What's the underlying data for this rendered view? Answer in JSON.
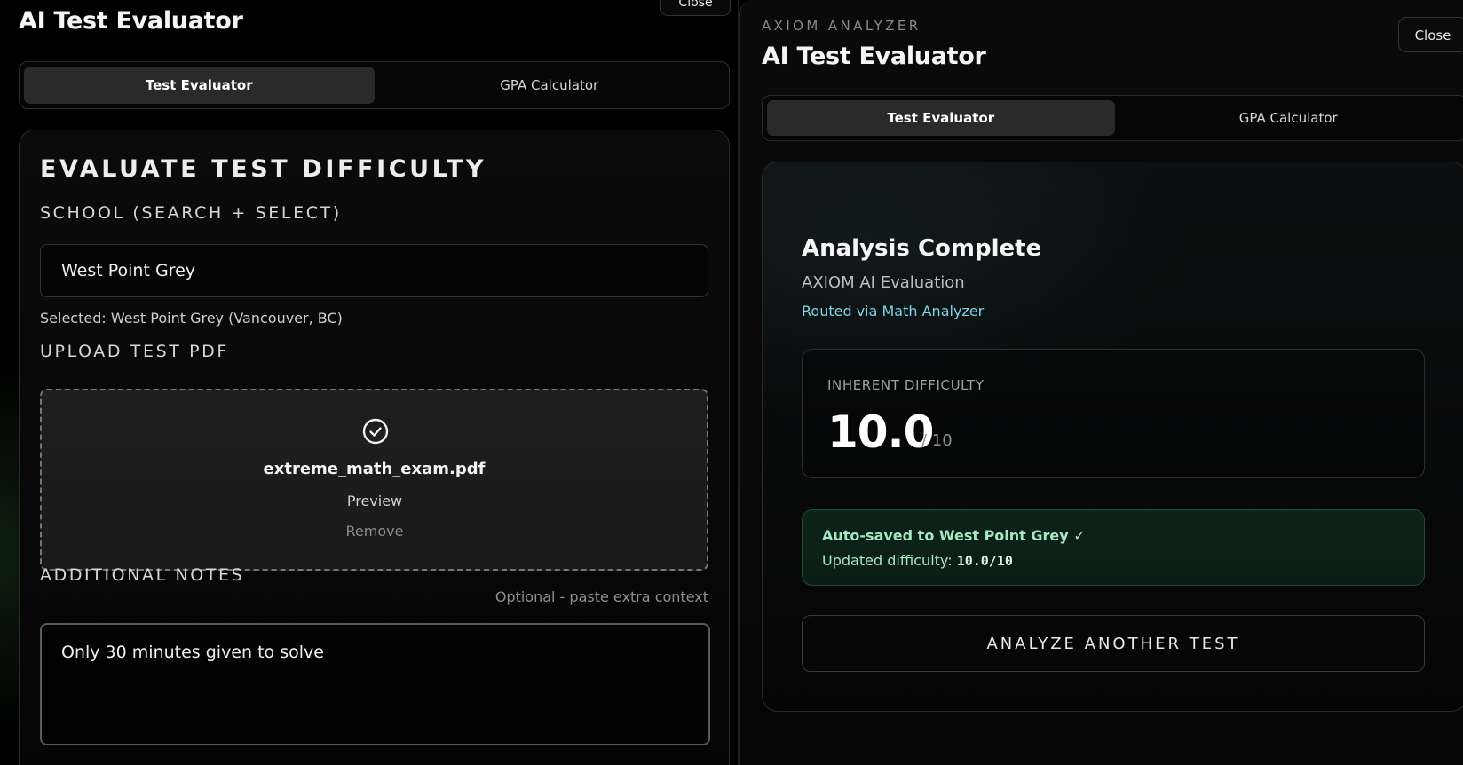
{
  "left": {
    "close_label": "Close",
    "title": "AI Test Evaluator",
    "tabs": [
      {
        "label": "Test Evaluator",
        "active": true
      },
      {
        "label": "GPA Calculator",
        "active": false
      }
    ],
    "card": {
      "heading": "EVALUATE TEST DIFFICULTY",
      "school_label": "SCHOOL (SEARCH + SELECT)",
      "school_value": "West Point Grey",
      "selected_note": "Selected: West Point Grey (Vancouver, BC)",
      "upload_label": "UPLOAD TEST PDF",
      "file_icon": "check-circle-icon",
      "file_name": "extreme_math_exam.pdf",
      "preview_label": "Preview",
      "remove_label": "Remove",
      "notes_label": "ADDITIONAL NOTES",
      "notes_hint": "Optional - paste extra context",
      "notes_value": "Only 30 minutes given to solve"
    }
  },
  "right": {
    "kicker": "AXIOM ANALYZER",
    "title": "AI Test Evaluator",
    "close_label": "Close",
    "tabs": [
      {
        "label": "Test Evaluator",
        "active": true
      },
      {
        "label": "GPA Calculator",
        "active": false
      }
    ],
    "result": {
      "title": "Analysis Complete",
      "subtitle": "AXIOM AI Evaluation",
      "routed": "Routed via Math Analyzer",
      "difficulty_label": "INHERENT DIFFICULTY",
      "difficulty_value": "10.0",
      "difficulty_scale": "/ 10",
      "saved_line": "Auto-saved to West Point Grey ✓",
      "updated_prefix": "Updated difficulty: ",
      "updated_value": "10.0/10",
      "analyze_label": "ANALYZE ANOTHER TEST"
    }
  },
  "colors": {
    "accent_link": "#7fd3e6",
    "success_text": "#a6e6c4",
    "success_bg": "#0d2419"
  }
}
